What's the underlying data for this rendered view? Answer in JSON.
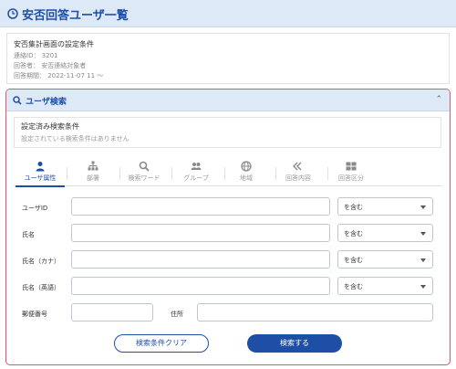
{
  "page": {
    "title": "安否回答ユーザ一覧"
  },
  "settings": {
    "title": "安否集計画面の設定条件",
    "rows": [
      "連絡ID： 3201",
      "回答者： 安否連絡対象者",
      "回答期間： 2022-11-07 11 〜"
    ]
  },
  "search": {
    "title": "ユーザ検索",
    "conditions_title": "設定済み検索条件",
    "conditions_empty": "設定されている検索条件はありません",
    "tabs": [
      {
        "label": "ユーザ属性",
        "icon": "person-icon"
      },
      {
        "label": "部署",
        "icon": "org-tree-icon"
      },
      {
        "label": "検索ワード",
        "icon": "magnifier-icon"
      },
      {
        "label": "グループ",
        "icon": "group-icon"
      },
      {
        "label": "地域",
        "icon": "globe-icon"
      },
      {
        "label": "回答内容",
        "icon": "reply-icon"
      },
      {
        "label": "回答区分",
        "icon": "grid-icon"
      }
    ],
    "active_tab": "ユーザ属性",
    "fields": {
      "user_id": {
        "label": "ユーザID",
        "match": "を含む"
      },
      "name": {
        "label": "氏名",
        "match": "を含む"
      },
      "name_kana": {
        "label": "氏名（カナ）",
        "match": "を含む"
      },
      "name_en": {
        "label": "氏名（英語）",
        "match": "を含む"
      },
      "postal": {
        "label": "郵便番号"
      },
      "address": {
        "label": "住所"
      }
    },
    "clear_button": "検索条件クリア",
    "search_button": "検索する"
  },
  "colors": {
    "accent": "#1e4fa6",
    "highlight_border": "#e0536a",
    "header_bg": "#dde9f7"
  }
}
